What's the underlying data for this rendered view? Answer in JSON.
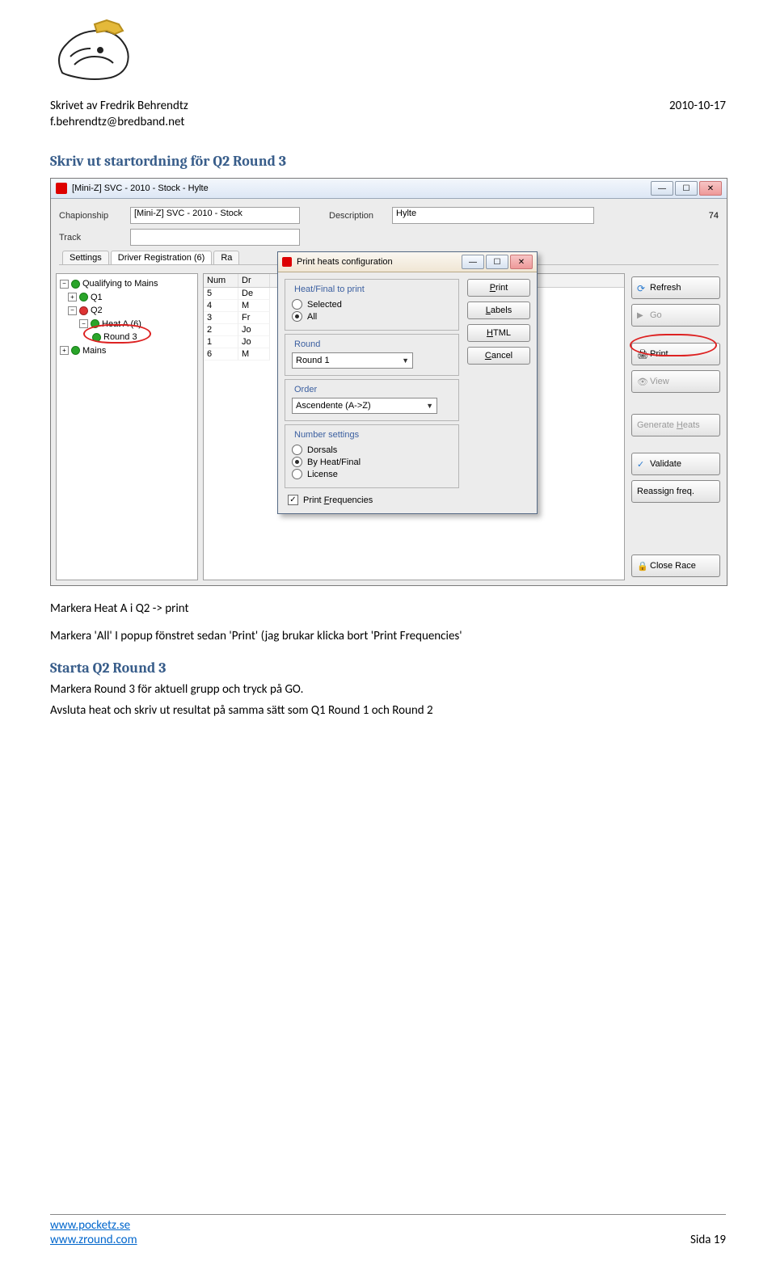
{
  "header": {
    "author_line": "Skrivet av Fredrik Behrendtz",
    "email": "f.behrendtz@bredband.net",
    "date": "2010-10-17"
  },
  "section1_title": "Skriv ut startordning för Q2 Round 3",
  "app": {
    "title": "[Mini-Z] SVC - 2010 - Stock - Hylte",
    "form": {
      "chapionship_label": "Chapionship",
      "chapionship_value": "[Mini-Z] SVC - 2010 - Stock",
      "description_label": "Description",
      "description_value": "Hylte",
      "id_value": "74",
      "track_label": "Track",
      "track_value": ""
    },
    "tabs": {
      "settings": "Settings",
      "driver_reg": "Driver Registration (6)",
      "ra": "Ra"
    },
    "tree": {
      "q_to_mains": "Qualifying to Mains",
      "q1": "Q1",
      "q2": "Q2",
      "heat_a": "Heat A (6)",
      "round3": "Round 3",
      "mains": "Mains"
    },
    "grid": {
      "num_head": "Num",
      "dr_head": "Dr",
      "rows": [
        {
          "num": "5",
          "dr": "De"
        },
        {
          "num": "4",
          "dr": "M"
        },
        {
          "num": "3",
          "dr": "Fr"
        },
        {
          "num": "2",
          "dr": "Jo"
        },
        {
          "num": "1",
          "dr": "Jo"
        },
        {
          "num": "6",
          "dr": "M"
        }
      ]
    },
    "buttons": {
      "refresh": "Refresh",
      "go": "Go",
      "print": "Print",
      "view": "View",
      "generate_heats": "Generate Heats",
      "validate": "Validate",
      "reassign": "Reassign freq.",
      "close_race": "Close Race"
    }
  },
  "dialog": {
    "title": "Print heats configuration",
    "heat_final_legend": "Heat/Final to print",
    "selected": "Selected",
    "all": "All",
    "round_legend": "Round",
    "round_value": "Round 1",
    "order_legend": "Order",
    "order_value": "Ascendente (A->Z)",
    "number_legend": "Number settings",
    "dorsals": "Dorsals",
    "by_heat_final": "By Heat/Final",
    "license": "License",
    "print_freq": "Print Frequencies",
    "btn_print": "Print",
    "btn_labels": "Labels",
    "btn_html": "HTML",
    "btn_cancel": "Cancel"
  },
  "body": {
    "p1": "Markera Heat A i Q2 -> print",
    "p2": "Markera 'All' I popup fönstret sedan 'Print' (jag brukar klicka bort 'Print Frequencies'",
    "section2_title": "Starta Q2 Round 3",
    "p3": "Markera Round 3 för aktuell grupp och tryck på GO.",
    "p4": "Avsluta heat och skriv ut resultat på samma sätt som Q1 Round 1 och Round 2"
  },
  "footer": {
    "url1": "www.pocketz.se",
    "url2": "www.zround.com",
    "page": "Sida 19"
  }
}
